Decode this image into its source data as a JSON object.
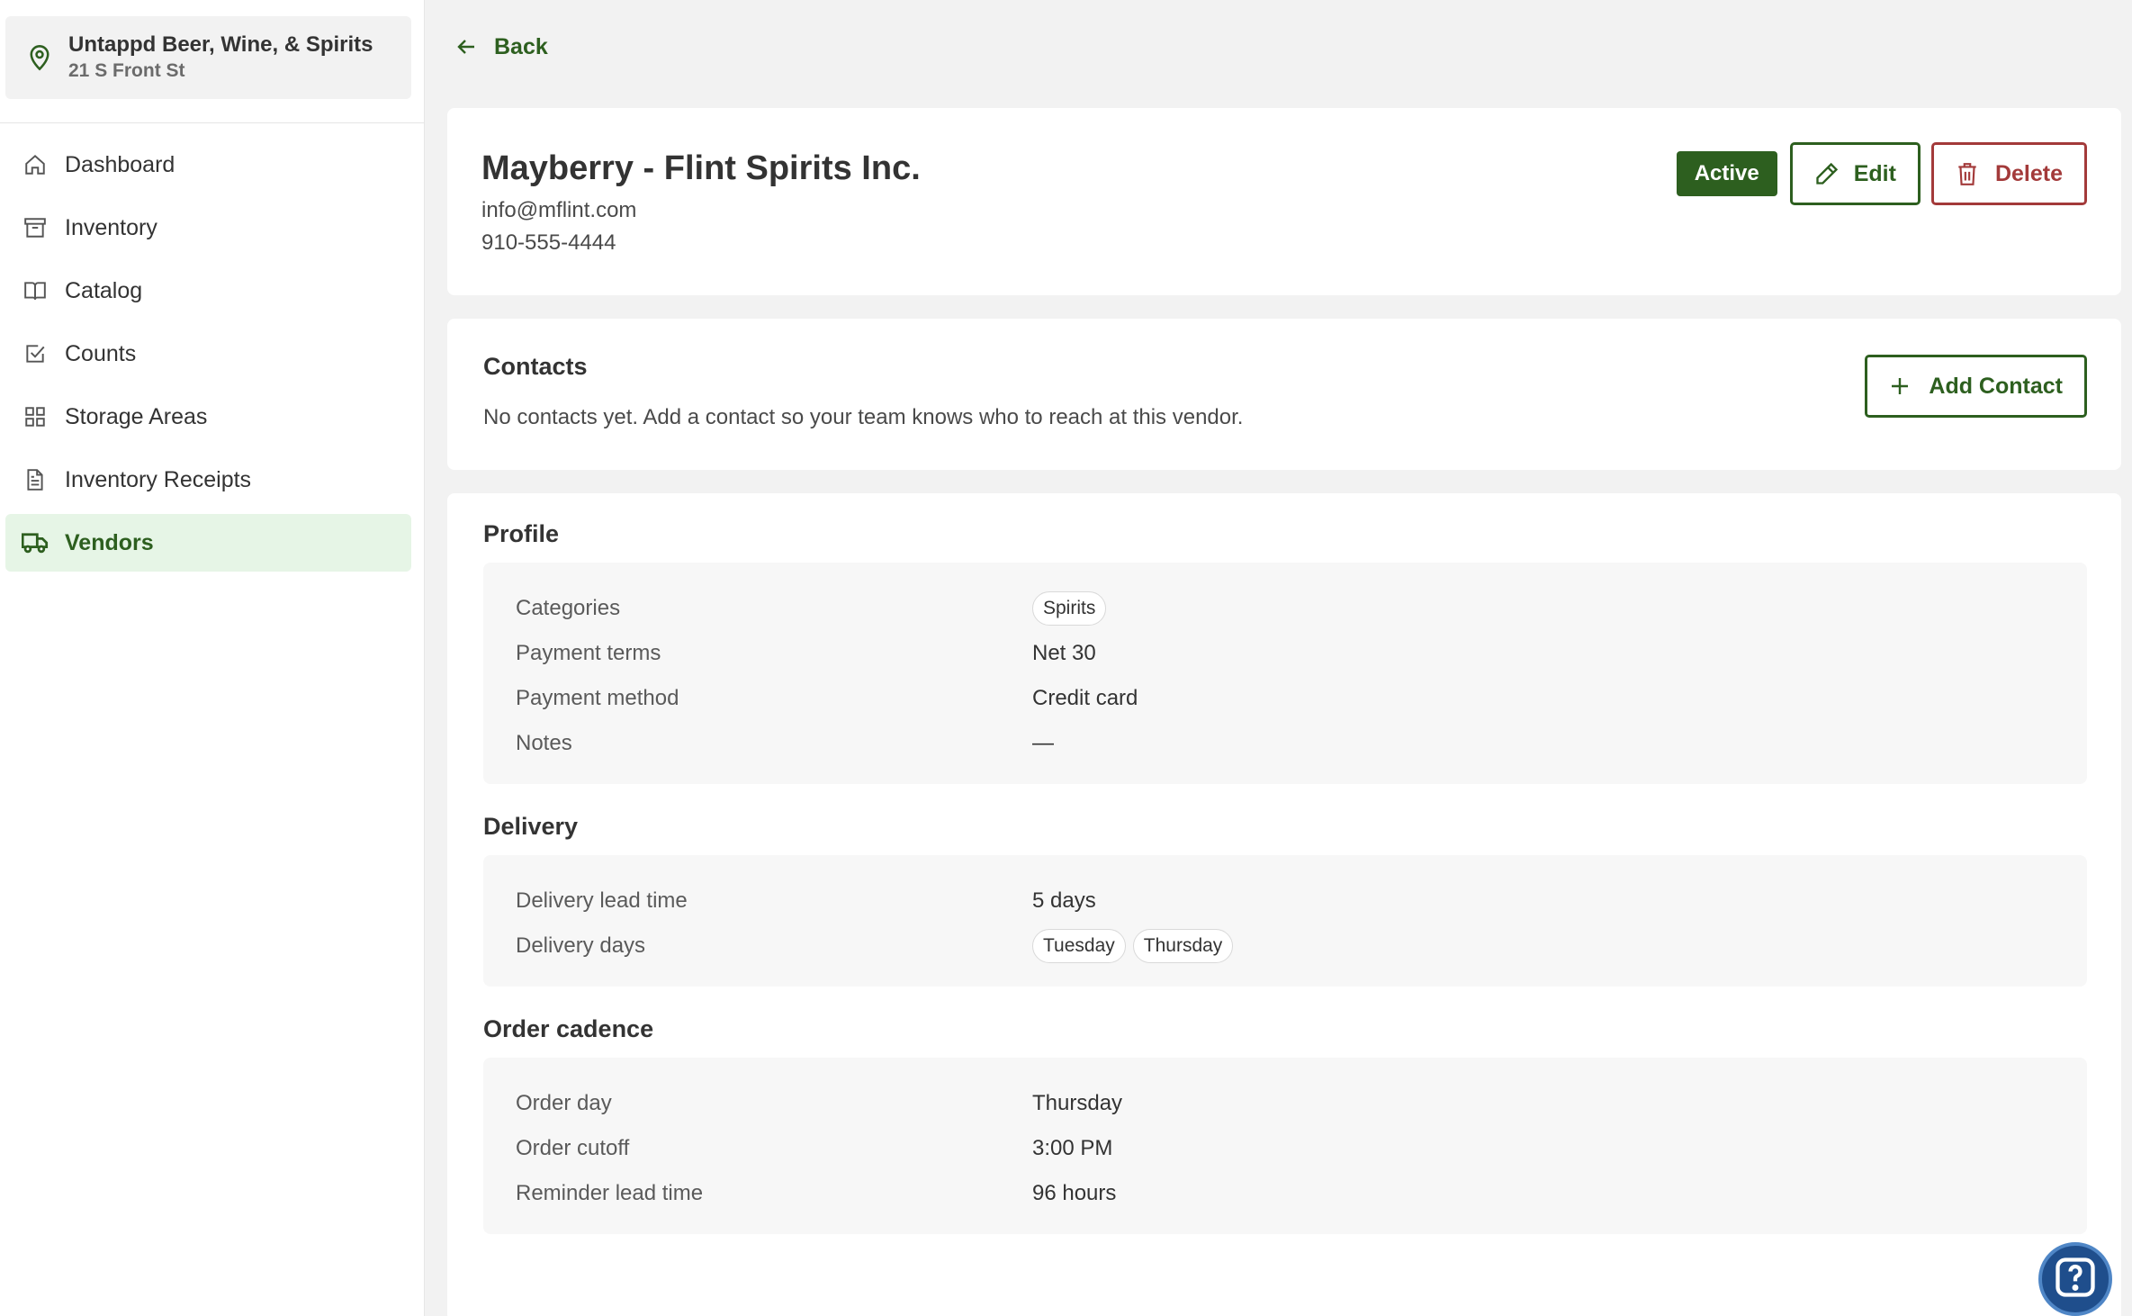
{
  "location": {
    "name": "Untappd Beer, Wine, & Spirits",
    "address": "21 S Front St"
  },
  "nav": {
    "items": [
      {
        "label": "Dashboard",
        "icon": "home-icon"
      },
      {
        "label": "Inventory",
        "icon": "archive-box-icon"
      },
      {
        "label": "Catalog",
        "icon": "book-icon"
      },
      {
        "label": "Counts",
        "icon": "checkbox-icon"
      },
      {
        "label": "Storage Areas",
        "icon": "grid-icon"
      },
      {
        "label": "Inventory Receipts",
        "icon": "document-icon"
      },
      {
        "label": "Vendors",
        "icon": "truck-icon",
        "active": true
      }
    ]
  },
  "back_label": "Back",
  "vendor": {
    "name": "Mayberry - Flint Spirits Inc.",
    "email": "info@mflint.com",
    "phone": "910-555-4444",
    "status": "Active",
    "edit_label": "Edit",
    "delete_label": "Delete"
  },
  "contacts": {
    "title": "Contacts",
    "empty_text": "No contacts yet. Add a contact so your team knows who to reach at this vendor.",
    "add_label": "Add Contact"
  },
  "profile": {
    "title": "Profile",
    "categories_label": "Categories",
    "categories": [
      "Spirits"
    ],
    "payment_terms_label": "Payment terms",
    "payment_terms": "Net 30",
    "payment_method_label": "Payment method",
    "payment_method": "Credit card",
    "notes_label": "Notes",
    "notes": "—"
  },
  "delivery": {
    "title": "Delivery",
    "lead_time_label": "Delivery lead time",
    "lead_time": "5 days",
    "days_label": "Delivery days",
    "days": [
      "Tuesday",
      "Thursday"
    ]
  },
  "order_cadence": {
    "title": "Order cadence",
    "order_day_label": "Order day",
    "order_day": "Thursday",
    "cutoff_label": "Order cutoff",
    "cutoff": "3:00 PM",
    "reminder_label": "Reminder lead time",
    "reminder": "96 hours"
  },
  "colors": {
    "brand_green": "#2d5f1f",
    "active_nav_bg": "#e6f5e6",
    "delete_red": "#a33a3a",
    "help_blue": "#1f4e8c"
  }
}
